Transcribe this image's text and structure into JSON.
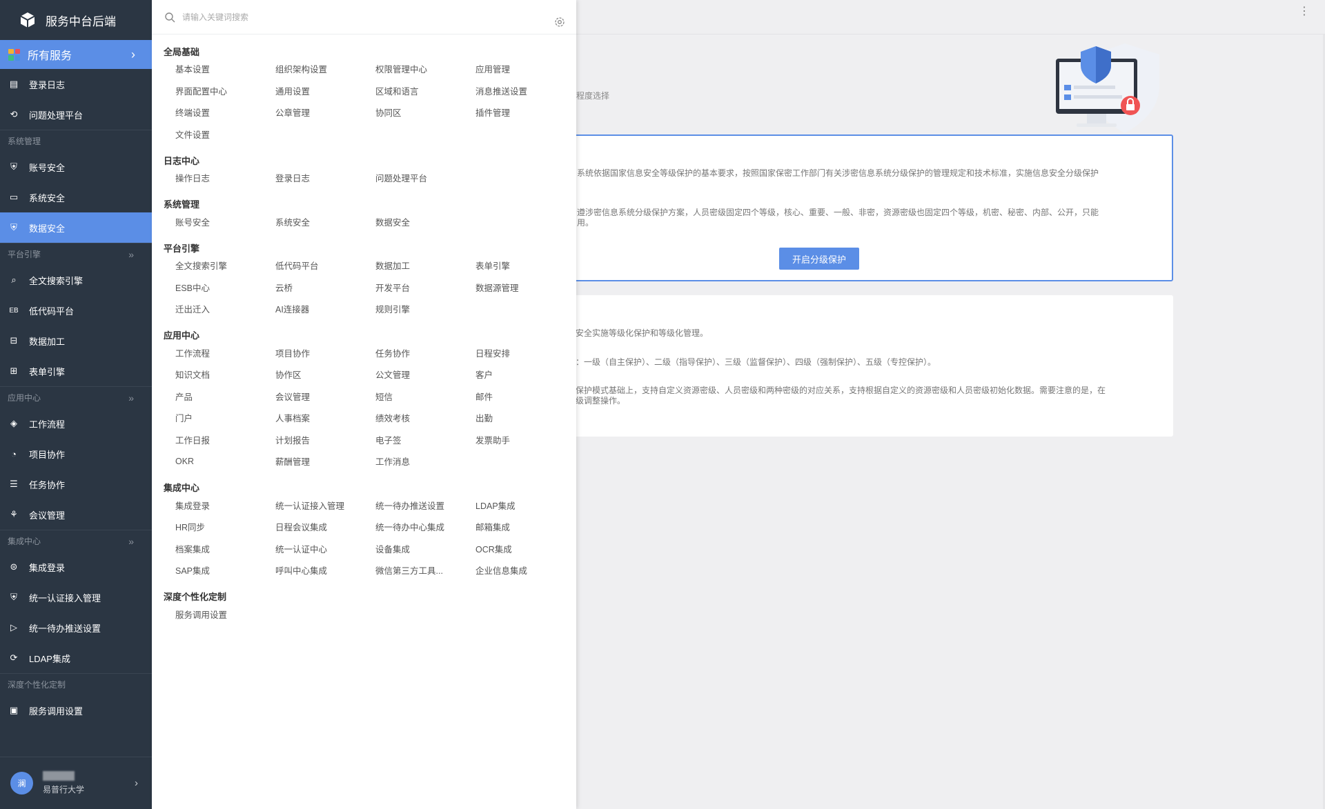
{
  "app": {
    "title": "服务中台后端"
  },
  "sidebar": {
    "all_services": "所有服务",
    "top_items": [
      {
        "label": "登录日志",
        "icon": "log-icon"
      },
      {
        "label": "问题处理平台",
        "icon": "issue-icon"
      }
    ],
    "groups": [
      {
        "title": "系统管理",
        "items": [
          {
            "label": "账号安全",
            "icon": "account-shield-icon",
            "active": false
          },
          {
            "label": "系统安全",
            "icon": "monitor-icon",
            "active": false
          },
          {
            "label": "数据安全",
            "icon": "data-shield-icon",
            "active": true
          }
        ]
      },
      {
        "title": "平台引擎",
        "items": [
          {
            "label": "全文搜索引擎",
            "icon": "search-icon"
          },
          {
            "label": "低代码平台",
            "icon": "eb-icon"
          },
          {
            "label": "数据加工",
            "icon": "data-process-icon"
          },
          {
            "label": "表单引擎",
            "icon": "form-icon"
          }
        ]
      },
      {
        "title": "应用中心",
        "items": [
          {
            "label": "工作流程",
            "icon": "workflow-icon"
          },
          {
            "label": "项目协作",
            "icon": "project-icon"
          },
          {
            "label": "任务协作",
            "icon": "task-icon"
          },
          {
            "label": "会议管理",
            "icon": "meeting-icon"
          }
        ]
      },
      {
        "title": "集成中心",
        "items": [
          {
            "label": "集成登录",
            "icon": "login-integration-icon"
          },
          {
            "label": "统一认证接入管理",
            "icon": "auth-icon"
          },
          {
            "label": "统一待办推送设置",
            "icon": "push-icon"
          },
          {
            "label": "LDAP集成",
            "icon": "ldap-icon"
          }
        ]
      },
      {
        "title": "深度个性化定制",
        "items": [
          {
            "label": "服务调用设置",
            "icon": "service-call-icon"
          }
        ]
      }
    ],
    "user": {
      "avatar_text": "澜",
      "org": "易普行大学"
    }
  },
  "panel": {
    "search_placeholder": "请输入关键词搜索",
    "sections": [
      {
        "title": "全局基础",
        "items": [
          "基本设置",
          "组织架构设置",
          "权限管理中心",
          "应用管理",
          "界面配置中心",
          "通用设置",
          "区域和语言",
          "消息推送设置",
          "终端设置",
          "公章管理",
          "协同区",
          "插件管理",
          "文件设置"
        ]
      },
      {
        "title": "日志中心",
        "items": [
          "操作日志",
          "登录日志",
          "问题处理平台"
        ]
      },
      {
        "title": "系统管理",
        "items": [
          "账号安全",
          "系统安全",
          "数据安全"
        ]
      },
      {
        "title": "平台引擎",
        "items": [
          "全文搜索引擎",
          "低代码平台",
          "数据加工",
          "表单引擎",
          "ESB中心",
          "云桥",
          "开发平台",
          "数据源管理",
          "迁出迁入",
          "AI连接器",
          "规则引擎"
        ]
      },
      {
        "title": "应用中心",
        "items": [
          "工作流程",
          "项目协作",
          "任务协作",
          "日程安排",
          "知识文档",
          "协作区",
          "公文管理",
          "客户",
          "产品",
          "会议管理",
          "短信",
          "邮件",
          "门户",
          "人事档案",
          "绩效考核",
          "出勤",
          "工作日报",
          "计划报告",
          "电子签",
          "发票助手",
          "OKR",
          "薪酬管理",
          "工作消息"
        ]
      },
      {
        "title": "集成中心",
        "items": [
          "集成登录",
          "统一认证接入管理",
          "统一待办推送设置",
          "LDAP集成",
          "HR同步",
          "日程会议集成",
          "统一待办中心集成",
          "邮箱集成",
          "档案集成",
          "统一认证中心",
          "设备集成",
          "OCR集成",
          "SAP集成",
          "呼叫中心集成",
          "微信第三方工具...",
          "企业信息集成"
        ]
      },
      {
        "title": "深度个性化定制",
        "items": [
          "服务调用设置"
        ]
      }
    ]
  },
  "main": {
    "hint": "程度选择",
    "card_a": {
      "line1": "系统依据国家信息安全等级保护的基本要求，按照国家保密工作部门有关涉密信息系统分级保护的管理规定和技术标准，实施信息安全分级保护",
      "line2": "遵涉密信息系统分级保护方案，人员密级固定四个等级，核心、重要、一般、非密，资源密级也固定四个等级，机密、秘密、内部、公开，只能",
      "line3": "用。",
      "button": "开启分级保护"
    },
    "card_b": {
      "line1": "安全实施等级化保护和等级化管理。",
      "line2": "：一级（自主保护）、二级（指导保护）、三级（监督保护）、四级（强制保护）、五级（专控保护）。",
      "line3": "保护模式基础上，支持自定义资源密级、人员密级和两种密级的对应关系，支持根据自定义的资源密级和人员密级初始化数据。需要注意的是，在",
      "line4": "级调整操作。"
    }
  },
  "colors": {
    "sidebar_bg": "#2b3643",
    "accent": "#5b8ee6",
    "page_bg": "#efeff1"
  }
}
